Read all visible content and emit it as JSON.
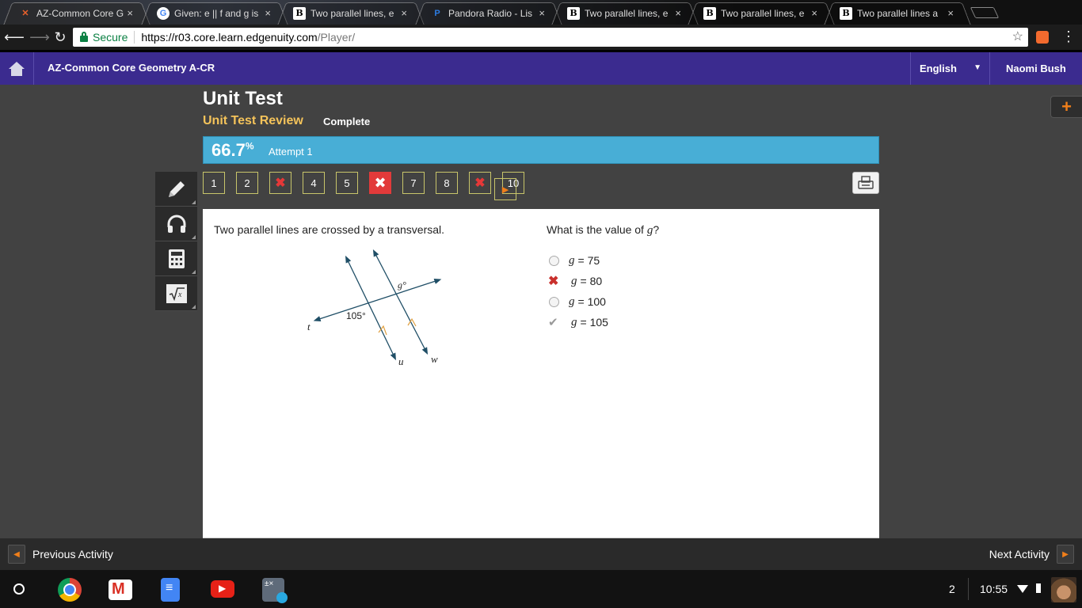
{
  "browser": {
    "tabs": [
      {
        "label": "AZ-Common Core G",
        "icon": "edgenuity-x-icon",
        "active": true
      },
      {
        "label": "Given: e || f and g is",
        "icon": "google-icon",
        "active": false
      },
      {
        "label": "Two parallel lines, e",
        "icon": "brainly-b-icon",
        "active": false
      },
      {
        "label": "Pandora Radio - Lis",
        "icon": "pandora-p-icon",
        "active": false
      },
      {
        "label": "Two parallel lines, e",
        "icon": "brainly-b-icon",
        "active": false
      },
      {
        "label": "Two parallel lines, e",
        "icon": "brainly-b-icon",
        "active": false
      },
      {
        "label": "Two parallel lines a",
        "icon": "brainly-b-icon",
        "active": false
      }
    ],
    "secure_label": "Secure",
    "url_host": "https://r03.core.learn.edgenuity.com",
    "url_path": "/Player/"
  },
  "header": {
    "course": "AZ-Common Core Geometry A-CR",
    "language": "English",
    "user": "Naomi Bush"
  },
  "page": {
    "title": "Unit Test",
    "subtitle": "Unit Test Review",
    "status": "Complete",
    "score": "66.7",
    "score_unit": "%",
    "attempt": "Attempt 1",
    "plus": "+"
  },
  "question_nav": [
    {
      "label": "1",
      "state": "normal"
    },
    {
      "label": "2",
      "state": "normal"
    },
    {
      "label": "✖",
      "state": "wrong"
    },
    {
      "label": "4",
      "state": "normal"
    },
    {
      "label": "5",
      "state": "normal"
    },
    {
      "label": "✖",
      "state": "current"
    },
    {
      "label": "7",
      "state": "normal"
    },
    {
      "label": "8",
      "state": "normal"
    },
    {
      "label": "✖",
      "state": "wrong"
    },
    {
      "label": "10",
      "state": "normal"
    },
    {
      "label": "▶",
      "state": "next"
    }
  ],
  "question": {
    "prompt": "Two parallel lines are crossed by a transversal.",
    "diagram": {
      "angle_g": "g°",
      "angle_105": "105°",
      "line_t": "t",
      "line_u": "u",
      "line_w": "w"
    },
    "text_prefix": "What is the value of ",
    "text_var": "g",
    "text_suffix": "?",
    "answers": [
      {
        "var": "g",
        "text": "= 75",
        "mark": "none"
      },
      {
        "var": "g",
        "text": "= 80",
        "mark": "incorrect-selected"
      },
      {
        "var": "g",
        "text": "= 100",
        "mark": "none"
      },
      {
        "var": "g",
        "text": "= 105",
        "mark": "correct"
      }
    ]
  },
  "footer": {
    "previous": "Previous Activity",
    "next": "Next Activity"
  },
  "shelf": {
    "notifications": "2",
    "time": "10:55"
  },
  "colors": {
    "header_bg": "#3b2b8f",
    "score_bar": "#48aed6",
    "subtitle": "#f4c35a",
    "accent_orange": "#f07f1a",
    "wrong_red": "#e23a3a",
    "diagram_line": "#1f4e66"
  }
}
